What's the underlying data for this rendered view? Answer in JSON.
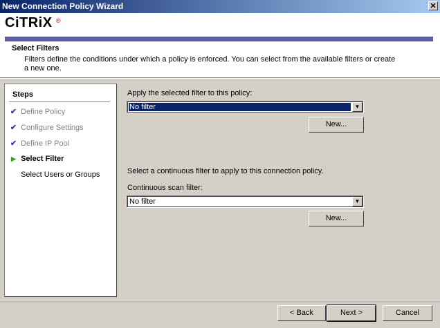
{
  "window": {
    "title": "New Connection Policy Wizard",
    "close_glyph": "✕"
  },
  "header": {
    "logo_text": "CiTRiX",
    "logo_mark": "®",
    "section_title": "Select Filters",
    "section_description": "Filters define the conditions under which a policy is enforced. You can select from the available filters or create a new one."
  },
  "steps": {
    "title": "Steps",
    "items": [
      {
        "label": "Define Policy",
        "mark": "✔",
        "state": "done"
      },
      {
        "label": "Configure Settings",
        "mark": "✔",
        "state": "done"
      },
      {
        "label": "Define IP Pool",
        "mark": "✔",
        "state": "done"
      },
      {
        "label": "Select Filter",
        "mark": "▶",
        "state": "current"
      },
      {
        "label": "Select Users or Groups",
        "mark": "",
        "state": "todo"
      }
    ]
  },
  "main": {
    "filter_label": "Apply the selected filter to this policy:",
    "filter_value": "No filter",
    "new_filter_button": "New...",
    "continuous_intro": "Select a continuous filter to apply to this connection policy.",
    "continuous_label": "Continuous scan filter:",
    "continuous_value": "No filter",
    "new_continuous_button": "New...",
    "dropdown_arrow": "▼"
  },
  "footer": {
    "back_button": "< Back",
    "next_button": "Next >",
    "cancel_button": "Cancel"
  }
}
